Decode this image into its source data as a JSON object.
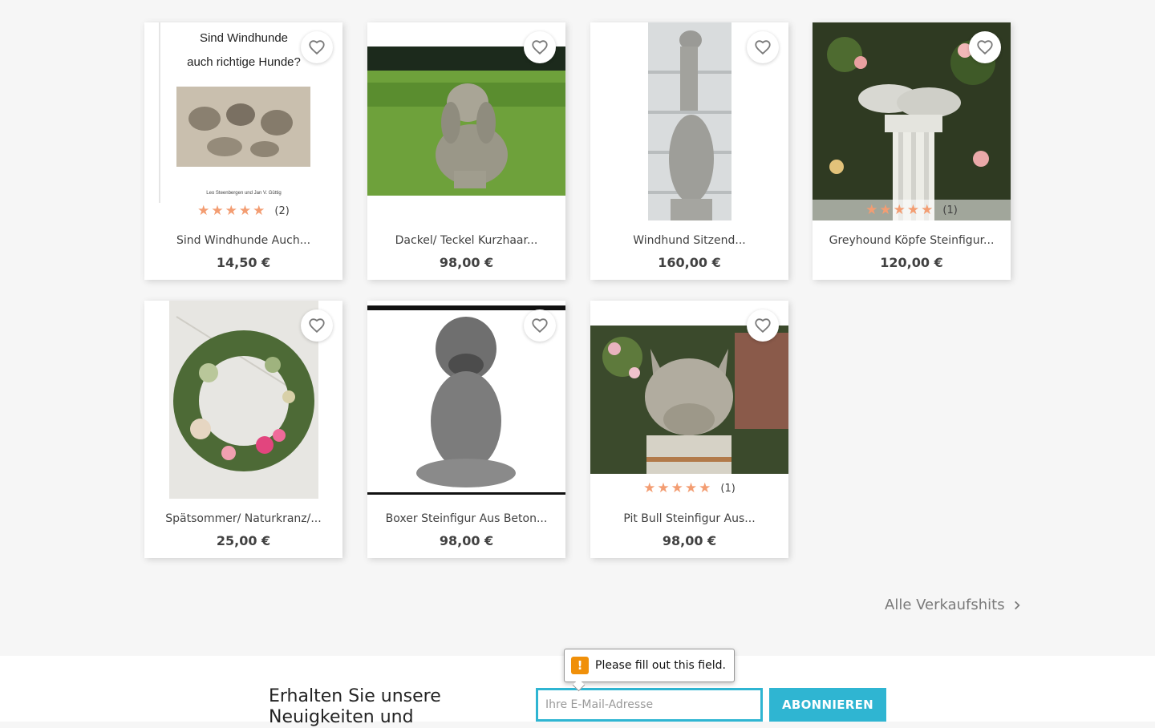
{
  "products": [
    {
      "name": "Sind Windhunde Auch...",
      "price": "14,50 €",
      "rating_count": "(2)",
      "stars": 5,
      "image": "book-cover",
      "cover_title_1": "Sind Windhunde",
      "cover_title_2": "auch richtige Hunde?",
      "cover_authors": "Leo Steenbergen und Jan V. Güttig"
    },
    {
      "name": "Dackel/ Teckel Kurzhaar...",
      "price": "98,00 €",
      "image": "dachshund-statue-garden"
    },
    {
      "name": "Windhund Sitzend...",
      "price": "160,00 €",
      "image": "sitting-greyhound-statue"
    },
    {
      "name": "Greyhound Köpfe Steinfigur...",
      "price": "120,00 €",
      "rating_count": "(1)",
      "stars": 5,
      "image": "greyhound-heads-on-column"
    },
    {
      "name": "Spätsommer/ Naturkranz/...",
      "price": "25,00 €",
      "image": "flower-wreath"
    },
    {
      "name": "Boxer Steinfigur Aus Beton...",
      "price": "98,00 €",
      "image": "boxer-statue-bw"
    },
    {
      "name": "Pit Bull Steinfigur Aus...",
      "price": "98,00 €",
      "rating_count": "(1)",
      "stars": 5,
      "image": "pitbull-head-statue"
    }
  ],
  "all_bestsellers": "Alle Verkaufshits",
  "newsletter": {
    "text": "Erhalten Sie unsere Neuigkeiten und",
    "placeholder": "Ihre E-Mail-Adresse",
    "button": "ABONNIEREN"
  },
  "validation_tooltip": "Please fill out this field.",
  "colors": {
    "accent": "#2fb5d2",
    "star": "#f39d72",
    "warning": "#f0900a"
  },
  "icons": {
    "favorite": "heart-outline-icon",
    "more": "chevron-right-icon",
    "warning": "exclamation-icon"
  }
}
